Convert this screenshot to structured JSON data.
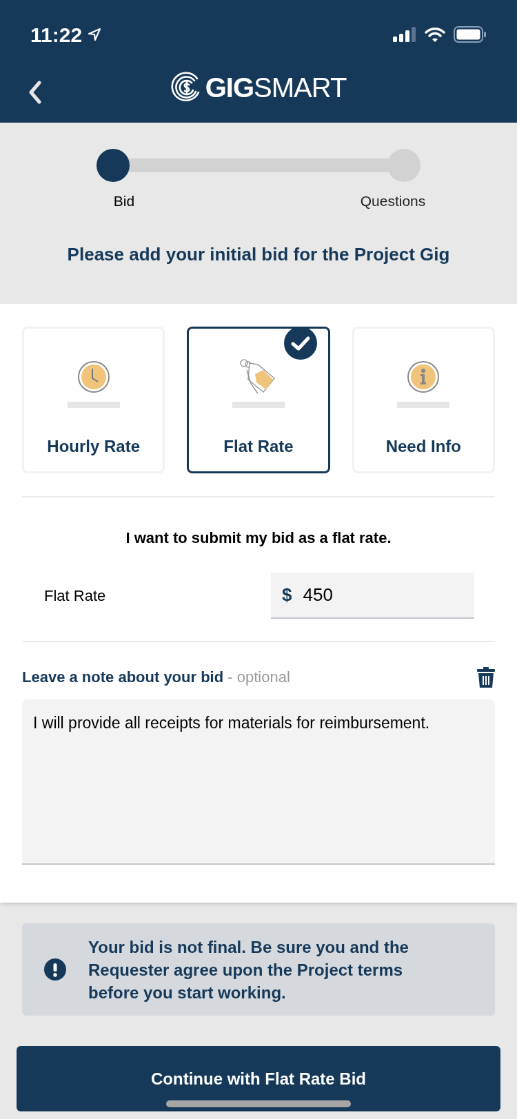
{
  "status_bar": {
    "time": "11:22"
  },
  "header": {
    "logo": "**GIG**SMART"
  },
  "stepper": [
    {
      "label": "Bid",
      "selected": true
    },
    {
      "label": "Questions",
      "selected": false
    }
  ],
  "heading": "Please add your initial bid for the Project Gig",
  "options": [
    {
      "kind": "clock",
      "label": "Hourly Rate",
      "selected": false
    },
    {
      "kind": "tag",
      "label": "Flat Rate",
      "selected": true
    },
    {
      "kind": "info",
      "label": "Need Info",
      "selected": false
    }
  ],
  "description": "I want to submit my bid as a flat rate.",
  "rate_field": {
    "label": "Flat Rate",
    "prefix": "$",
    "value": "450"
  },
  "note": {
    "label": "**Leave a note about your bid** - optional",
    "value": "I will provide all receipts for materials for reimbursement."
  },
  "alert": "Your bid is not final. Be sure you and the Requester agree upon the Project terms before you start working.",
  "primary_button": "Continue with Flat Rate Bid"
}
